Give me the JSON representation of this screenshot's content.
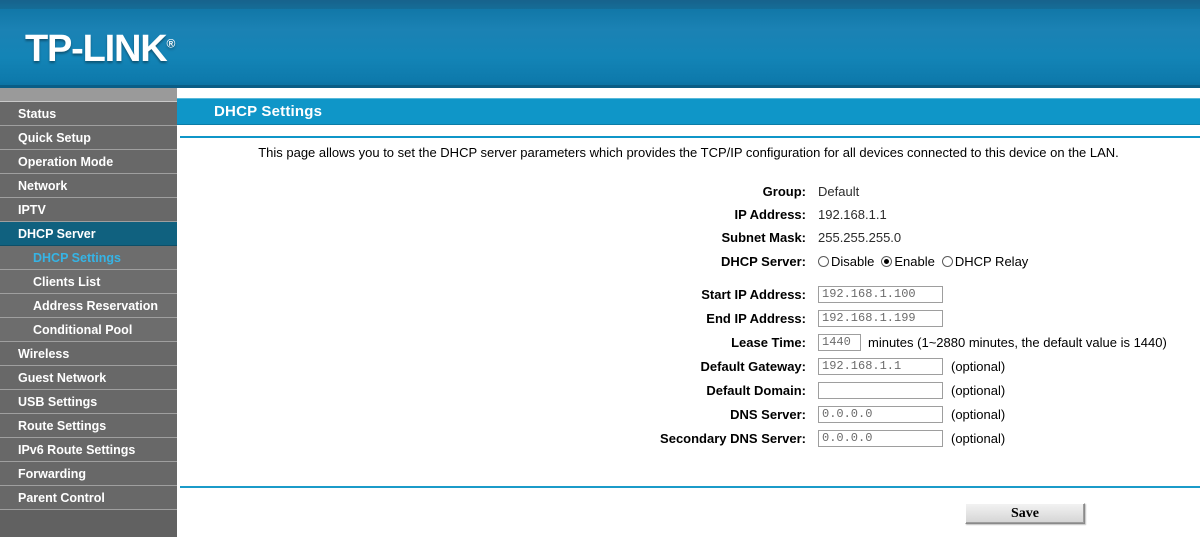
{
  "brand": {
    "name": "TP-LINK",
    "trademark": "®"
  },
  "sidebar": {
    "items": [
      {
        "label": "Status",
        "level": 1,
        "state": "normal"
      },
      {
        "label": "Quick Setup",
        "level": 1,
        "state": "normal"
      },
      {
        "label": "Operation Mode",
        "level": 1,
        "state": "normal"
      },
      {
        "label": "Network",
        "level": 1,
        "state": "normal"
      },
      {
        "label": "IPTV",
        "level": 1,
        "state": "normal"
      },
      {
        "label": "DHCP Server",
        "level": 1,
        "state": "active"
      },
      {
        "label": "DHCP Settings",
        "level": 2,
        "state": "current"
      },
      {
        "label": "Clients List",
        "level": 2,
        "state": "normal"
      },
      {
        "label": "Address Reservation",
        "level": 2,
        "state": "normal"
      },
      {
        "label": "Conditional Pool",
        "level": 2,
        "state": "normal"
      },
      {
        "label": "Wireless",
        "level": 1,
        "state": "normal"
      },
      {
        "label": "Guest Network",
        "level": 1,
        "state": "normal"
      },
      {
        "label": "USB Settings",
        "level": 1,
        "state": "normal"
      },
      {
        "label": "Route Settings",
        "level": 1,
        "state": "normal"
      },
      {
        "label": "IPv6 Route Settings",
        "level": 1,
        "state": "normal"
      },
      {
        "label": "Forwarding",
        "level": 1,
        "state": "normal"
      },
      {
        "label": "Parent Control",
        "level": 1,
        "state": "normal"
      }
    ]
  },
  "page": {
    "title": "DHCP Settings",
    "description": "This page allows you to set the DHCP server parameters which provides the TCP/IP configuration for all devices connected to this device on the LAN."
  },
  "form": {
    "group": {
      "label": "Group:",
      "value": "Default"
    },
    "ip_address": {
      "label": "IP Address:",
      "value": "192.168.1.1"
    },
    "subnet_mask": {
      "label": "Subnet Mask:",
      "value": "255.255.255.0"
    },
    "dhcp_server": {
      "label": "DHCP Server:",
      "options": [
        {
          "label": "Disable",
          "checked": false
        },
        {
          "label": "Enable",
          "checked": true
        },
        {
          "label": "DHCP Relay",
          "checked": false
        }
      ]
    },
    "start_ip": {
      "label": "Start IP Address:",
      "value": "192.168.1.100",
      "placeholder": ""
    },
    "end_ip": {
      "label": "End IP Address:",
      "value": "192.168.1.199",
      "placeholder": ""
    },
    "lease_time": {
      "label": "Lease Time:",
      "value": "1440",
      "hint": "minutes (1~2880 minutes, the default value is 1440)"
    },
    "default_gateway": {
      "label": "Default Gateway:",
      "value": "192.168.1.1",
      "note": "(optional)"
    },
    "default_domain": {
      "label": "Default Domain:",
      "value": "",
      "placeholder": "",
      "note": "(optional)"
    },
    "dns_server": {
      "label": "DNS Server:",
      "value": "0.0.0.0",
      "note": "(optional)"
    },
    "secondary_dns_server": {
      "label": "Secondary DNS Server:",
      "value": "0.0.0.0",
      "note": "(optional)"
    }
  },
  "actions": {
    "save_label": "Save"
  },
  "colors": {
    "header_blue": "#1384b6",
    "title_bar_blue": "#0f96c8",
    "sidebar_gray": "#686868",
    "active_nav": "#10617f",
    "current_nav_text": "#36b4e5"
  }
}
